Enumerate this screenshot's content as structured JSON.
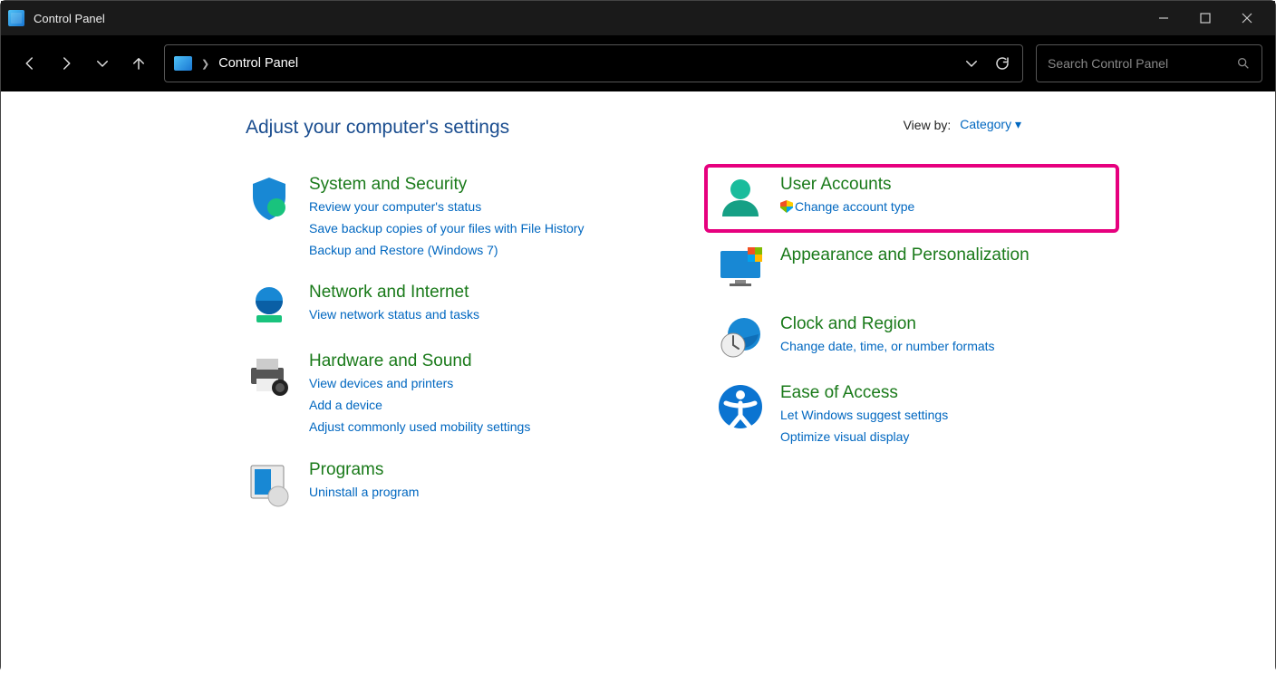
{
  "window": {
    "title": "Control Panel"
  },
  "toolbar": {
    "breadcrumb": "Control Panel"
  },
  "search": {
    "placeholder": "Search Control Panel"
  },
  "page": {
    "heading": "Adjust your computer's settings",
    "viewby_label": "View by:",
    "viewby_value": "Category ▾"
  },
  "left": {
    "system": {
      "title": "System and Security",
      "l1": "Review your computer's status",
      "l2": "Save backup copies of your files with File History",
      "l3": "Backup and Restore (Windows 7)"
    },
    "network": {
      "title": "Network and Internet",
      "l1": "View network status and tasks"
    },
    "hardware": {
      "title": "Hardware and Sound",
      "l1": "View devices and printers",
      "l2": "Add a device",
      "l3": "Adjust commonly used mobility settings"
    },
    "programs": {
      "title": "Programs",
      "l1": "Uninstall a program"
    }
  },
  "right": {
    "user": {
      "title": "User Accounts",
      "l1": "Change account type"
    },
    "appearance": {
      "title": "Appearance and Personalization"
    },
    "clock": {
      "title": "Clock and Region",
      "l1": "Change date, time, or number formats"
    },
    "ease": {
      "title": "Ease of Access",
      "l1": "Let Windows suggest settings",
      "l2": "Optimize visual display"
    }
  }
}
